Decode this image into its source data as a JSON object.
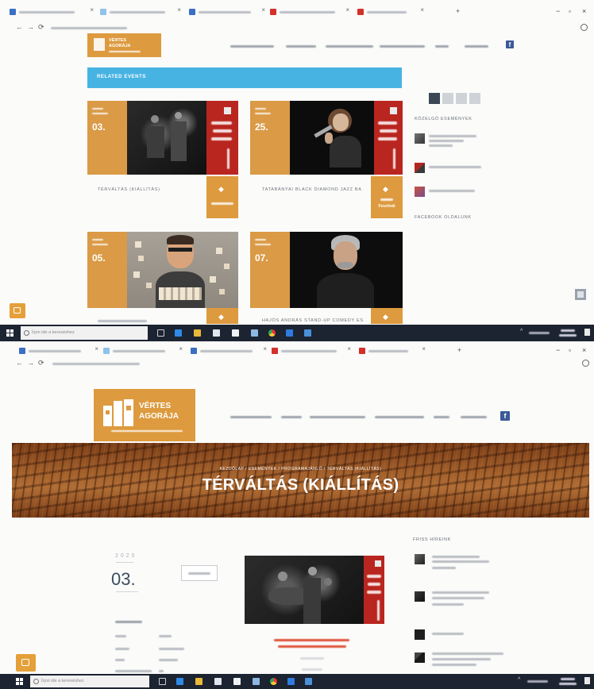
{
  "colors": {
    "brand_orange": "#dd9a3e",
    "related_bar": "#47b3e3",
    "taskbar": "#1c2331",
    "facebook": "#3b5998",
    "poster_red": "#b9261f"
  },
  "icons": {
    "facebook": "facebook-icon",
    "event_button": "diamond-icon",
    "start": "windows-icon",
    "search": "search-icon"
  },
  "logo": {
    "line1": "VÉRTES",
    "line2": "AGORÁJA"
  },
  "taskbar": {
    "search_placeholder": "Írjon ide a kereséshez"
  },
  "top_page": {
    "related_events_label": "RELATED EVENTS",
    "events": [
      {
        "day": "03.",
        "caption": "TÉRVÁLTÁS (KIÁLLÍTÁS)"
      },
      {
        "day": "25.",
        "caption": "TATABÁNYAI BLACK DIAMOND JAZZ BA",
        "button_label": "Fesztivál"
      },
      {
        "day": "05."
      },
      {
        "day": "07.",
        "caption": "HAJÓS ANDRÁS STAND-UP COMEDY ES"
      }
    ],
    "sidebar": {
      "upcoming_title": "KÖZELGŐ ESEMÉNYEK",
      "facebook_title": "FACEBOOK OLDALUNK"
    }
  },
  "detail_page": {
    "breadcrumb": "KEZDŐLAP / ESEMÉNYEK / PROGRAMAJÁNLÓ / TÉRVÁLTÁS (KIÁLLÍTÁS)",
    "title": "TÉRVÁLTÁS (KIÁLLÍTÁS)",
    "year": "2020",
    "day": "03.",
    "sidebar_title": "FRISS HÍREINK"
  }
}
